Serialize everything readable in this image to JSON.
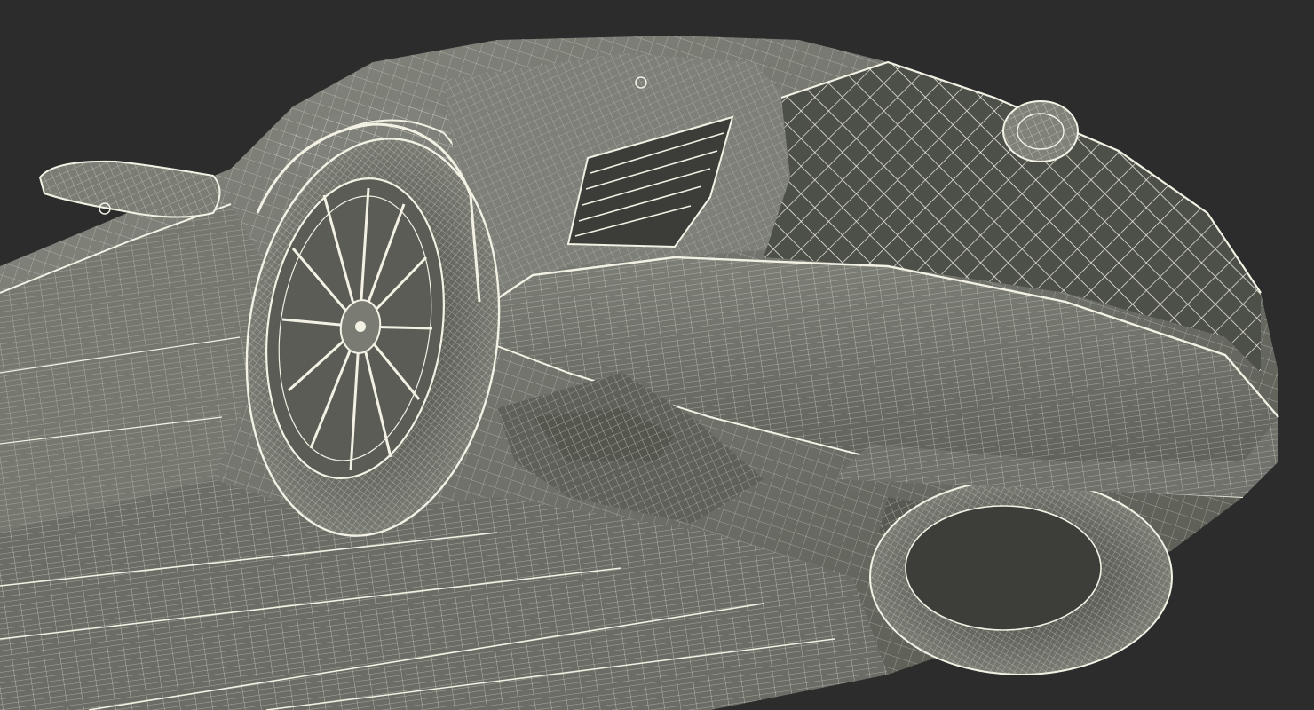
{
  "scene": {
    "subject": "car-wireframe-underside",
    "colors": {
      "background": "#2c2c2c",
      "surface": "#6f716a",
      "surface_light": "#8a8c84",
      "surface_dark": "#4a4c47",
      "wire": "#f2f1e4",
      "shadow": "#3a3b38"
    },
    "visible_parts": [
      "front-left-wheel",
      "rear-wheel",
      "side-mirror",
      "front-fender",
      "air-vent",
      "front-grille",
      "front-emblem",
      "front-bumper-underside",
      "underbody-panels",
      "suspension",
      "door-side-panel"
    ]
  }
}
